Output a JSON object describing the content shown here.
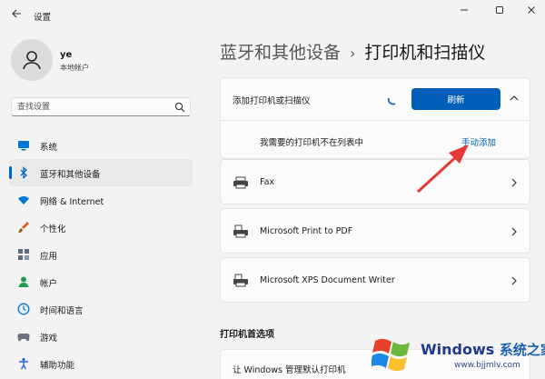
{
  "window": {
    "title": "设置",
    "back_icon": "back-arrow-icon",
    "controls": [
      "minimize-icon",
      "maximize-icon",
      "close-icon"
    ]
  },
  "profile": {
    "name": "ye",
    "account_type": "本地帐户"
  },
  "search": {
    "placeholder": "查找设置"
  },
  "sidebar": {
    "items": [
      {
        "label": "系统",
        "icon": "system-icon",
        "color": "#0078d4"
      },
      {
        "label": "蓝牙和其他设备",
        "icon": "bluetooth-icon",
        "color": "#0067c0",
        "active": true
      },
      {
        "label": "网络 & Internet",
        "icon": "wifi-icon",
        "color": "#0078d4"
      },
      {
        "label": "个性化",
        "icon": "brush-icon",
        "color": "#d8621a"
      },
      {
        "label": "应用",
        "icon": "apps-icon",
        "color": "#5f6b7a"
      },
      {
        "label": "帐户",
        "icon": "account-icon",
        "color": "#1f9d55"
      },
      {
        "label": "时间和语言",
        "icon": "clock-globe-icon",
        "color": "#0078d4"
      },
      {
        "label": "游戏",
        "icon": "gamepad-icon",
        "color": "#6b7280"
      },
      {
        "label": "辅助功能",
        "icon": "accessibility-icon",
        "color": "#2563eb"
      }
    ]
  },
  "breadcrumb": {
    "parent": "蓝牙和其他设备",
    "separator": "›",
    "current": "打印机和扫描仪"
  },
  "add_device": {
    "title": "添加打印机或扫描仪",
    "refresh_label": "刷新",
    "not_listed_text": "我需要的打印机不在列表中",
    "manual_add_label": "手动添加"
  },
  "printers": [
    {
      "name": "Fax",
      "icon": "fax-icon"
    },
    {
      "name": "Microsoft Print to PDF",
      "icon": "printer-icon"
    },
    {
      "name": "Microsoft XPS Document Writer",
      "icon": "printer-icon"
    }
  ],
  "preferences": {
    "section_title": "打印机首选项",
    "default_printer_label": "让 Windows 管理默认打印机"
  },
  "watermark": {
    "brand": "Windows",
    "brand_cn": "系统之家",
    "url": "www.bjjmlv.com"
  },
  "colors": {
    "accent": "#005fb8",
    "annotation_arrow": "#e53935"
  }
}
